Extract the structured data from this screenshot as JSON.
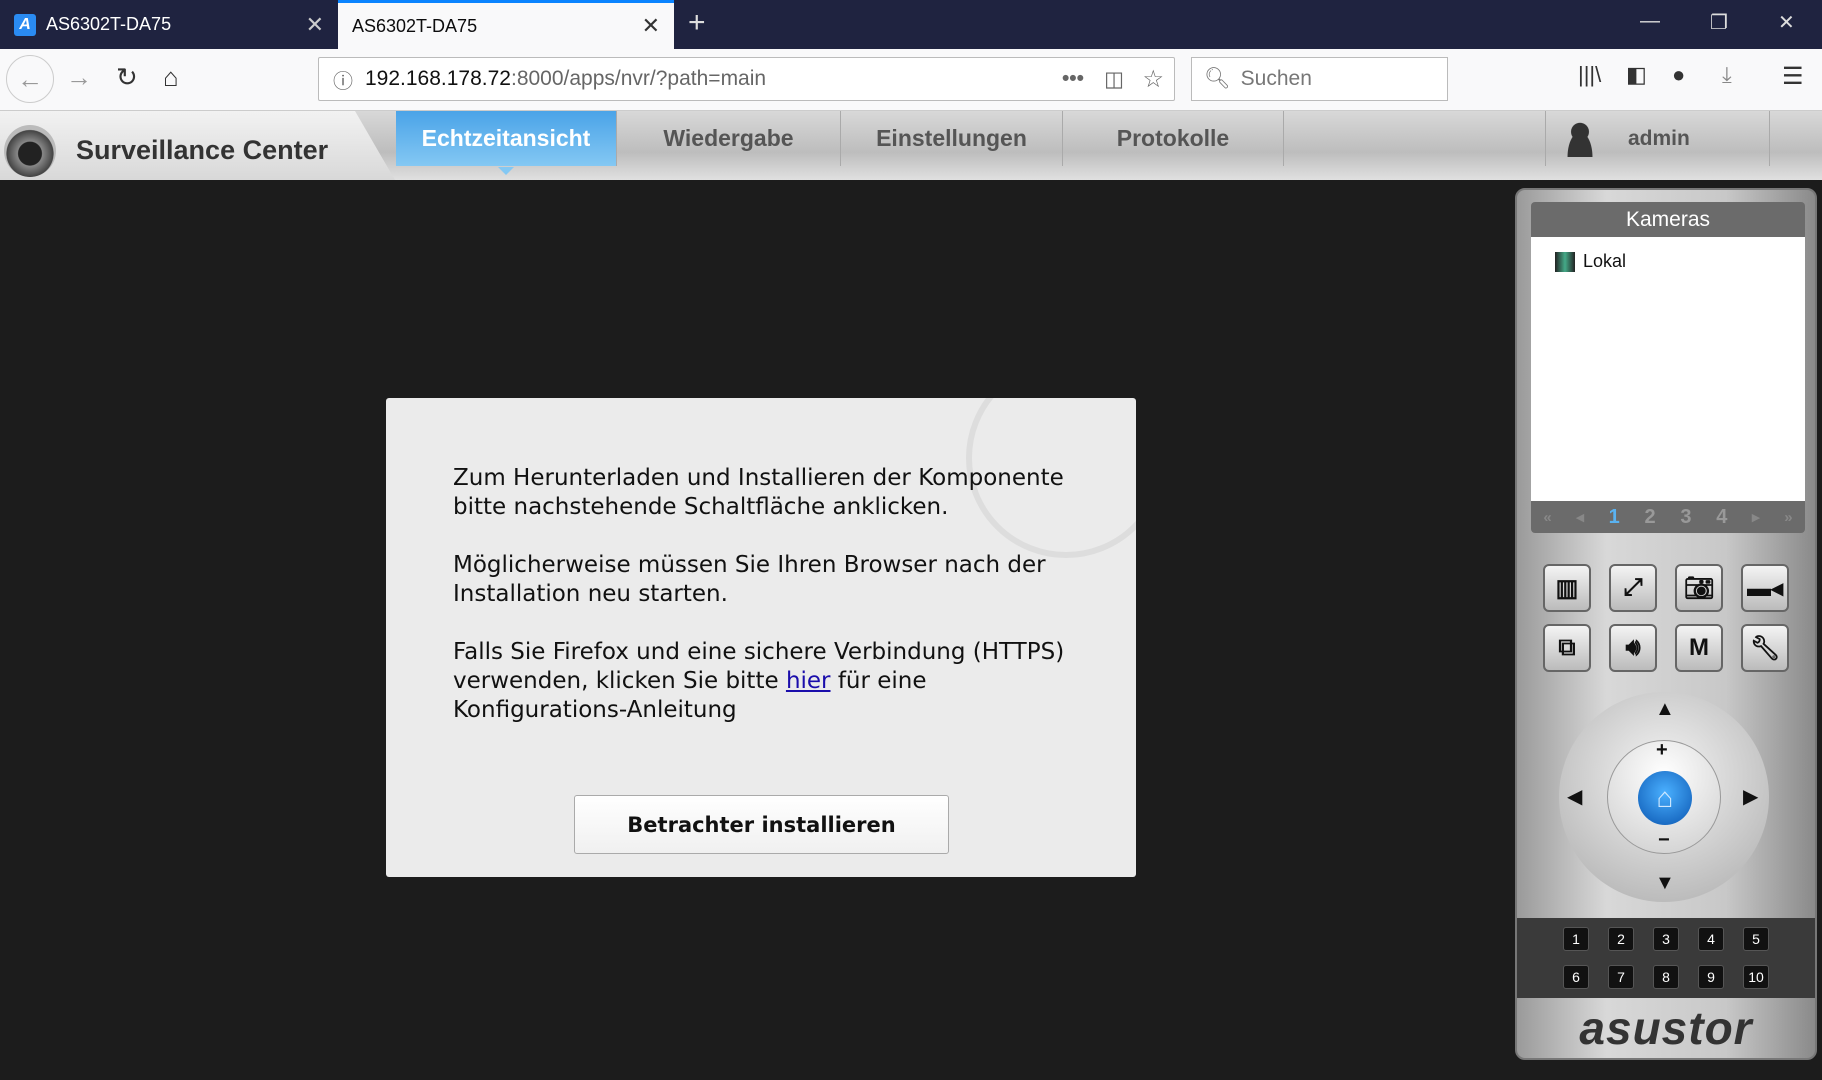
{
  "browser": {
    "tabs": [
      {
        "title": "AS6302T-DA75",
        "active": false
      },
      {
        "title": "AS6302T-DA75",
        "active": true
      }
    ],
    "url_host": "192.168.178.72",
    "url_rest": ":8000/apps/nvr/?path=main",
    "search_placeholder": "Suchen"
  },
  "app": {
    "title": "Surveillance Center",
    "nav": [
      "Echtzeitansicht",
      "Wiedergabe",
      "Einstellungen",
      "Protokolle"
    ],
    "active_nav": "Echtzeitansicht",
    "user": "admin"
  },
  "dialog": {
    "p1": "Zum Herunterladen und Installieren der Komponente bitte nachstehende Schaltfläche anklicken.",
    "p2": "Möglicherweise müssen Sie Ihren Browser nach der Installation neu starten.",
    "p3_before": "Falls Sie Firefox und eine sichere Verbindung (HTTPS) verwenden, klicken Sie bitte ",
    "p3_link": "hier",
    "p3_after": " für eine Konfigurations-Anleitung",
    "button": "Betrachter installieren"
  },
  "panel": {
    "header": "Kameras",
    "cameras": [
      "Lokal"
    ],
    "pages": [
      "1",
      "2",
      "3",
      "4"
    ],
    "current_page": "1",
    "presets": [
      "1",
      "2",
      "3",
      "4",
      "5",
      "6",
      "7",
      "8",
      "9",
      "10"
    ],
    "brand": "asustor"
  },
  "colors": {
    "accent": "#4aa3e8",
    "tabbar": "#1f2340"
  }
}
